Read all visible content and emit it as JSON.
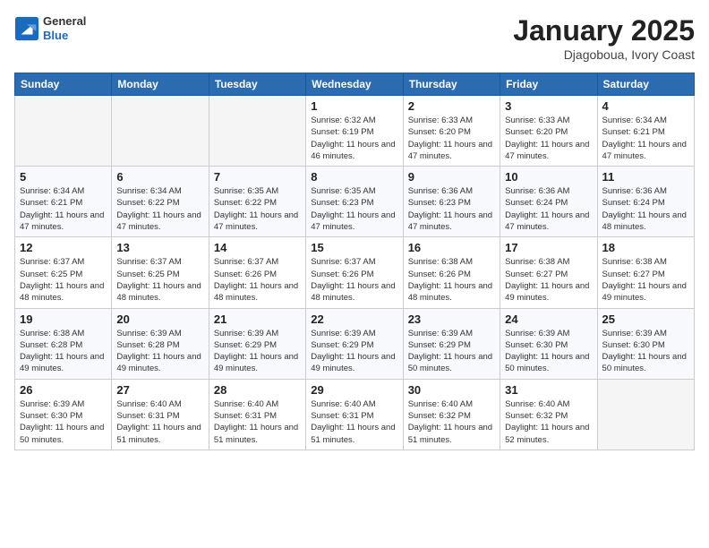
{
  "header": {
    "logo_general": "General",
    "logo_blue": "Blue",
    "title": "January 2025",
    "subtitle": "Djagoboua, Ivory Coast"
  },
  "calendar": {
    "days_of_week": [
      "Sunday",
      "Monday",
      "Tuesday",
      "Wednesday",
      "Thursday",
      "Friday",
      "Saturday"
    ],
    "weeks": [
      [
        {
          "day": "",
          "info": ""
        },
        {
          "day": "",
          "info": ""
        },
        {
          "day": "",
          "info": ""
        },
        {
          "day": "1",
          "info": "Sunrise: 6:32 AM\nSunset: 6:19 PM\nDaylight: 11 hours and 46 minutes."
        },
        {
          "day": "2",
          "info": "Sunrise: 6:33 AM\nSunset: 6:20 PM\nDaylight: 11 hours and 47 minutes."
        },
        {
          "day": "3",
          "info": "Sunrise: 6:33 AM\nSunset: 6:20 PM\nDaylight: 11 hours and 47 minutes."
        },
        {
          "day": "4",
          "info": "Sunrise: 6:34 AM\nSunset: 6:21 PM\nDaylight: 11 hours and 47 minutes."
        }
      ],
      [
        {
          "day": "5",
          "info": "Sunrise: 6:34 AM\nSunset: 6:21 PM\nDaylight: 11 hours and 47 minutes."
        },
        {
          "day": "6",
          "info": "Sunrise: 6:34 AM\nSunset: 6:22 PM\nDaylight: 11 hours and 47 minutes."
        },
        {
          "day": "7",
          "info": "Sunrise: 6:35 AM\nSunset: 6:22 PM\nDaylight: 11 hours and 47 minutes."
        },
        {
          "day": "8",
          "info": "Sunrise: 6:35 AM\nSunset: 6:23 PM\nDaylight: 11 hours and 47 minutes."
        },
        {
          "day": "9",
          "info": "Sunrise: 6:36 AM\nSunset: 6:23 PM\nDaylight: 11 hours and 47 minutes."
        },
        {
          "day": "10",
          "info": "Sunrise: 6:36 AM\nSunset: 6:24 PM\nDaylight: 11 hours and 47 minutes."
        },
        {
          "day": "11",
          "info": "Sunrise: 6:36 AM\nSunset: 6:24 PM\nDaylight: 11 hours and 48 minutes."
        }
      ],
      [
        {
          "day": "12",
          "info": "Sunrise: 6:37 AM\nSunset: 6:25 PM\nDaylight: 11 hours and 48 minutes."
        },
        {
          "day": "13",
          "info": "Sunrise: 6:37 AM\nSunset: 6:25 PM\nDaylight: 11 hours and 48 minutes."
        },
        {
          "day": "14",
          "info": "Sunrise: 6:37 AM\nSunset: 6:26 PM\nDaylight: 11 hours and 48 minutes."
        },
        {
          "day": "15",
          "info": "Sunrise: 6:37 AM\nSunset: 6:26 PM\nDaylight: 11 hours and 48 minutes."
        },
        {
          "day": "16",
          "info": "Sunrise: 6:38 AM\nSunset: 6:26 PM\nDaylight: 11 hours and 48 minutes."
        },
        {
          "day": "17",
          "info": "Sunrise: 6:38 AM\nSunset: 6:27 PM\nDaylight: 11 hours and 49 minutes."
        },
        {
          "day": "18",
          "info": "Sunrise: 6:38 AM\nSunset: 6:27 PM\nDaylight: 11 hours and 49 minutes."
        }
      ],
      [
        {
          "day": "19",
          "info": "Sunrise: 6:38 AM\nSunset: 6:28 PM\nDaylight: 11 hours and 49 minutes."
        },
        {
          "day": "20",
          "info": "Sunrise: 6:39 AM\nSunset: 6:28 PM\nDaylight: 11 hours and 49 minutes."
        },
        {
          "day": "21",
          "info": "Sunrise: 6:39 AM\nSunset: 6:29 PM\nDaylight: 11 hours and 49 minutes."
        },
        {
          "day": "22",
          "info": "Sunrise: 6:39 AM\nSunset: 6:29 PM\nDaylight: 11 hours and 49 minutes."
        },
        {
          "day": "23",
          "info": "Sunrise: 6:39 AM\nSunset: 6:29 PM\nDaylight: 11 hours and 50 minutes."
        },
        {
          "day": "24",
          "info": "Sunrise: 6:39 AM\nSunset: 6:30 PM\nDaylight: 11 hours and 50 minutes."
        },
        {
          "day": "25",
          "info": "Sunrise: 6:39 AM\nSunset: 6:30 PM\nDaylight: 11 hours and 50 minutes."
        }
      ],
      [
        {
          "day": "26",
          "info": "Sunrise: 6:39 AM\nSunset: 6:30 PM\nDaylight: 11 hours and 50 minutes."
        },
        {
          "day": "27",
          "info": "Sunrise: 6:40 AM\nSunset: 6:31 PM\nDaylight: 11 hours and 51 minutes."
        },
        {
          "day": "28",
          "info": "Sunrise: 6:40 AM\nSunset: 6:31 PM\nDaylight: 11 hours and 51 minutes."
        },
        {
          "day": "29",
          "info": "Sunrise: 6:40 AM\nSunset: 6:31 PM\nDaylight: 11 hours and 51 minutes."
        },
        {
          "day": "30",
          "info": "Sunrise: 6:40 AM\nSunset: 6:32 PM\nDaylight: 11 hours and 51 minutes."
        },
        {
          "day": "31",
          "info": "Sunrise: 6:40 AM\nSunset: 6:32 PM\nDaylight: 11 hours and 52 minutes."
        },
        {
          "day": "",
          "info": ""
        }
      ]
    ]
  }
}
